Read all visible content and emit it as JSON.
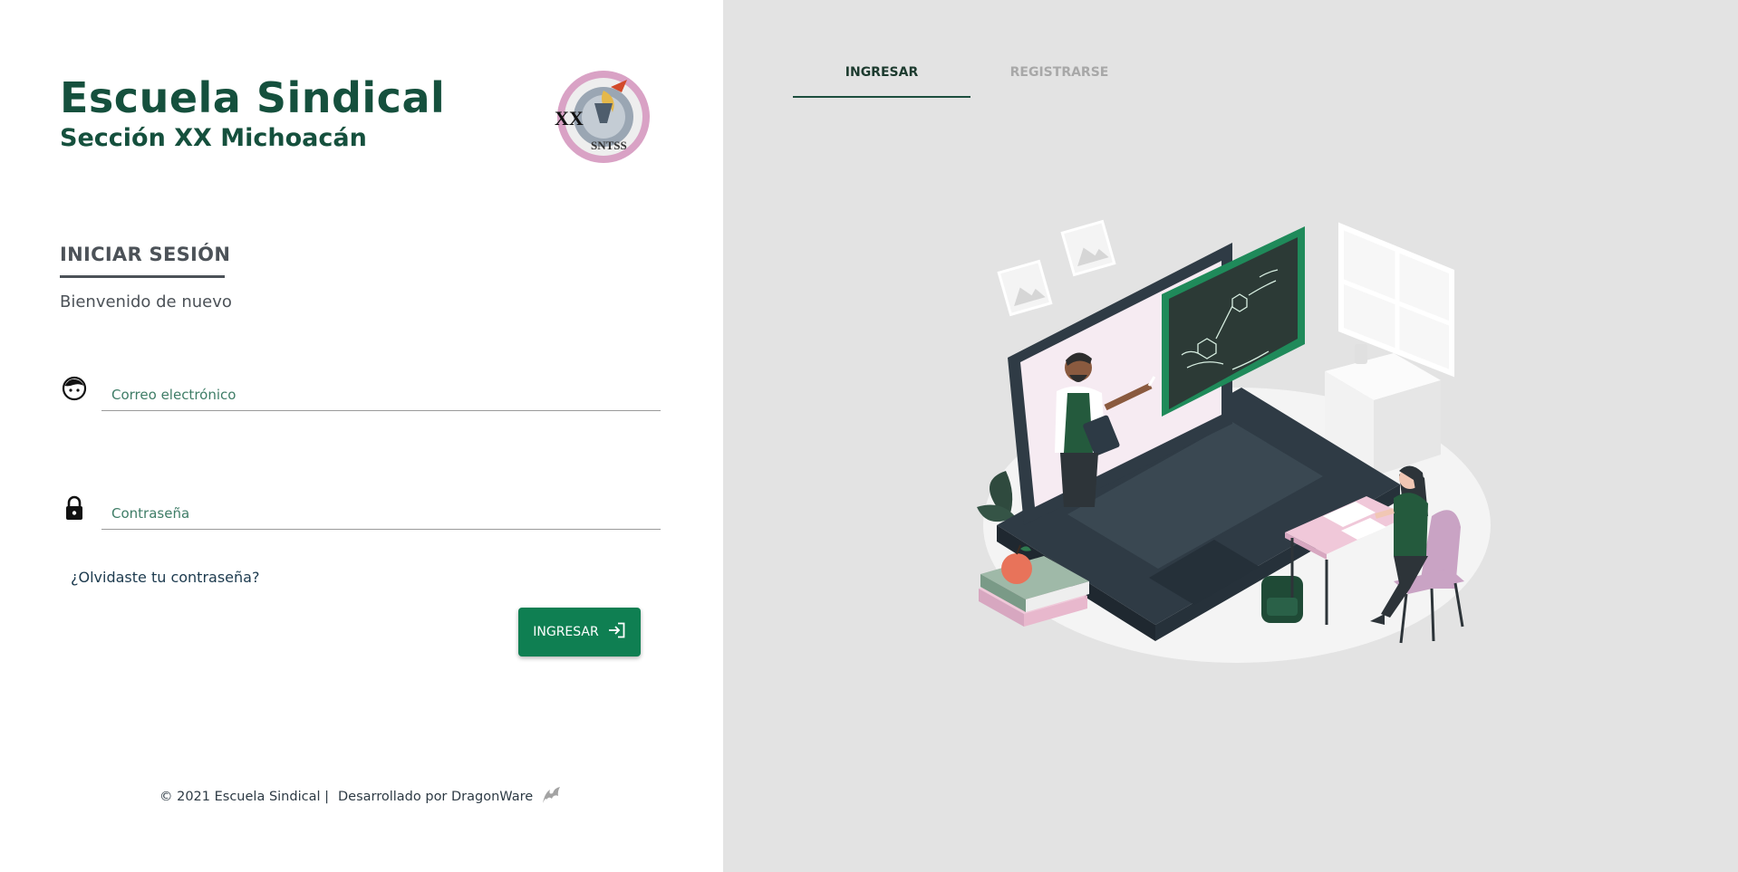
{
  "brand": {
    "title": "Escuela Sindical",
    "subtitle": "Sección XX Michoacán",
    "logo": {
      "icon": "sntss-seal-logo",
      "text_left": "XX",
      "text_bottom": "SNTSS"
    }
  },
  "login": {
    "heading": "INICIAR SESIÓN",
    "welcome": "Bienvenido de nuevo",
    "email": {
      "icon": "face-icon",
      "placeholder": "Correo electrónico",
      "value": ""
    },
    "password": {
      "icon": "lock-icon",
      "placeholder": "Contraseña",
      "value": ""
    },
    "forgot_link": "¿Olvidaste tu contraseña?",
    "submit": {
      "label": "INGRESAR",
      "icon": "login-arrow-icon"
    }
  },
  "footer": {
    "copyright": "© 2021 Escuela Sindical |",
    "developer": "Desarrollado por DragonWare",
    "icon": "dragon-icon"
  },
  "tabs": [
    {
      "label": "INGRESAR",
      "active": true
    },
    {
      "label": "REGISTRARSE",
      "active": false
    }
  ],
  "illustration": {
    "icon": "online-class-illustration"
  },
  "colors": {
    "brand_green": "#15503d",
    "button_green": "#0f7f52",
    "chalkboard_green": "#1f8a5a",
    "right_panel_bg": "#e3e3e3",
    "text_gray": "#4c5258"
  }
}
